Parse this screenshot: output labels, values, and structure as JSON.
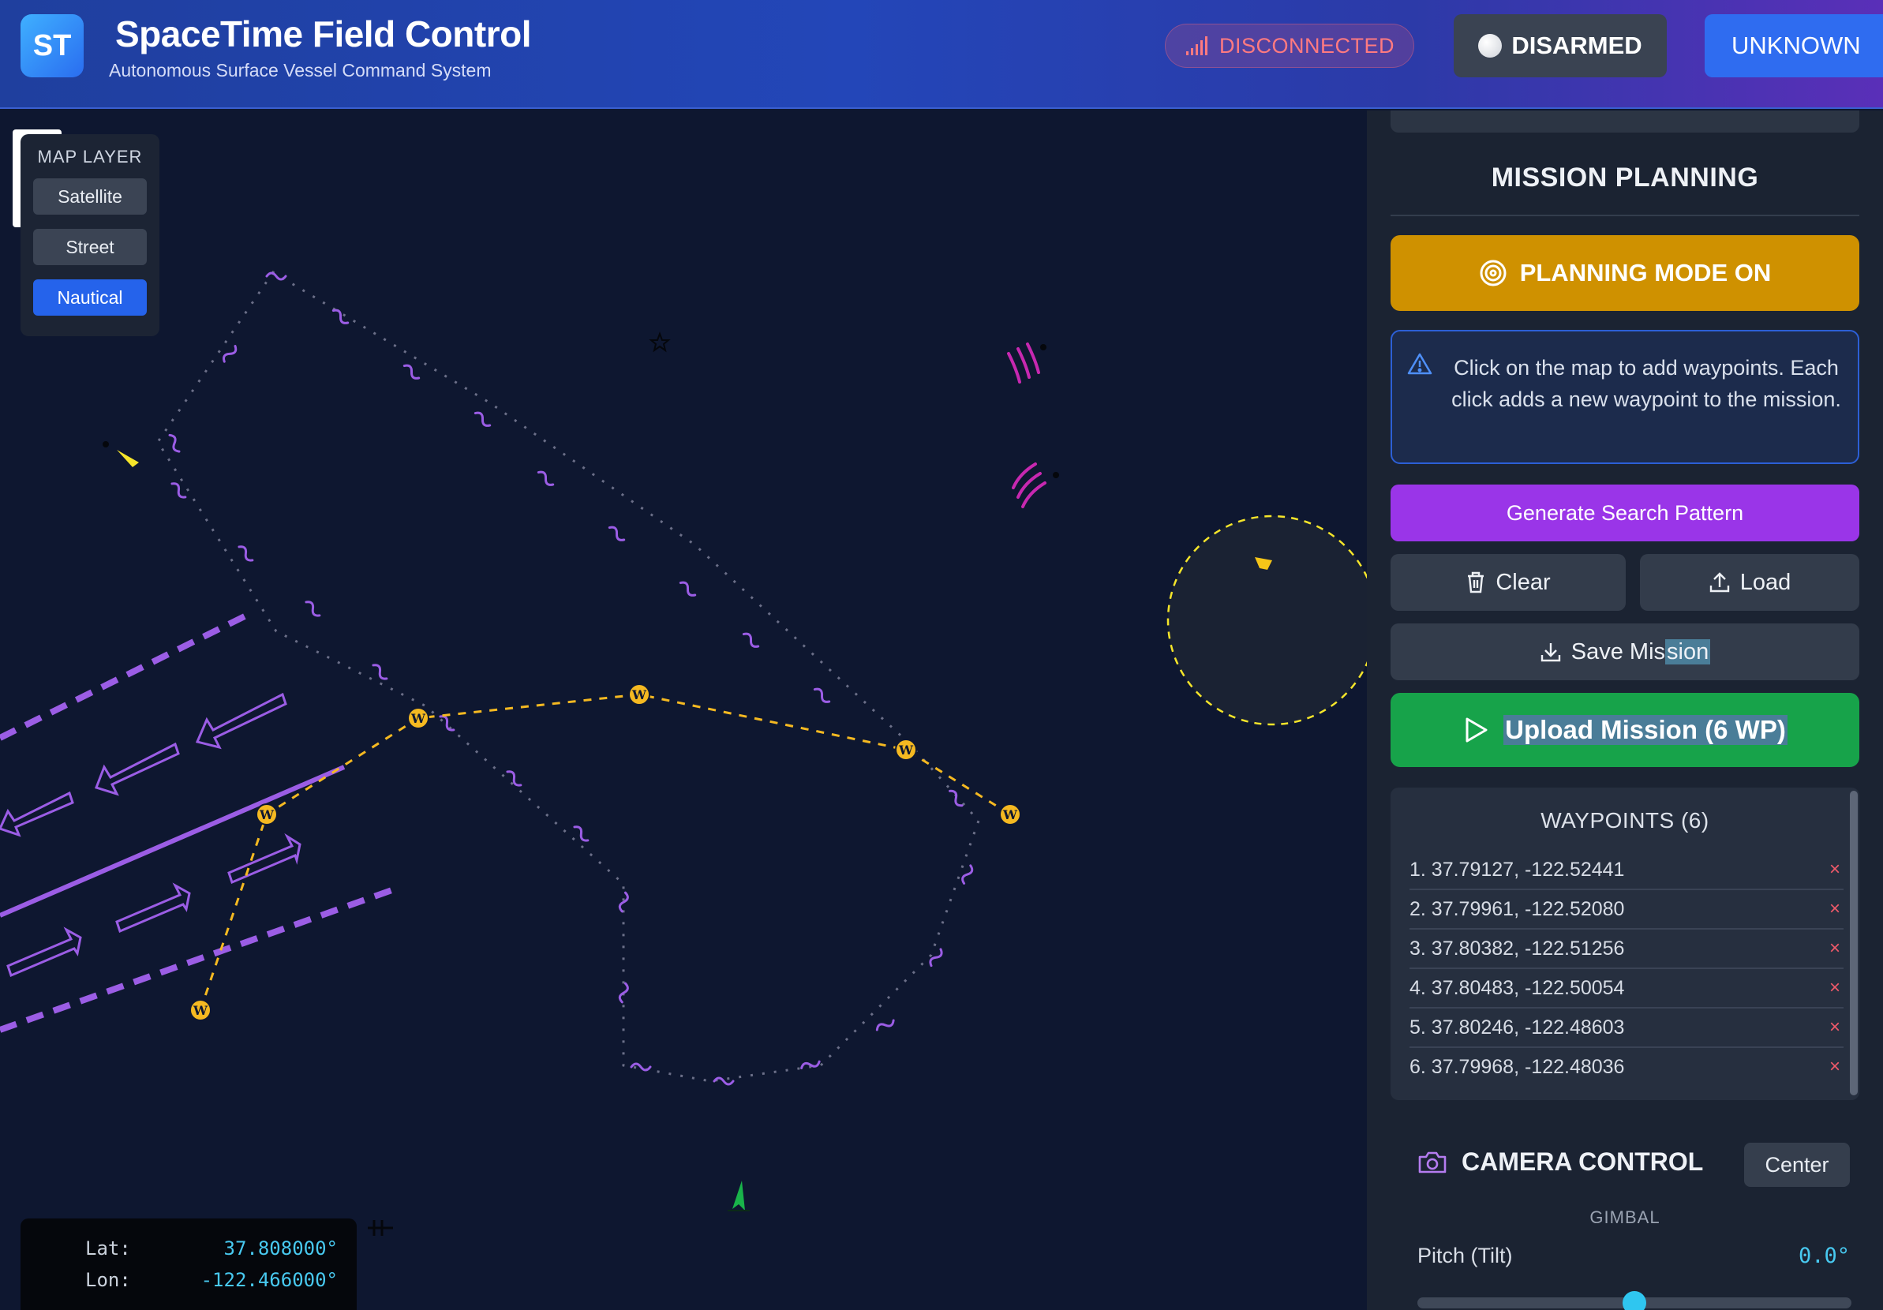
{
  "header": {
    "logo_text": "ST",
    "title": "SpaceTime Field Control",
    "subtitle": "Autonomous Surface Vessel Command System",
    "connection_status": "DISCONNECTED",
    "arm_status": "DISARMED",
    "mode": "UNKNOWN"
  },
  "map": {
    "layer_title": "MAP LAYER",
    "layers": [
      "Satellite",
      "Street",
      "Nautical"
    ],
    "active_layer": "Nautical",
    "waypoint_marker": "W",
    "coords": {
      "lat_label": "Lat:",
      "lat_value": "37.808000°",
      "lon_label": "Lon:",
      "lon_value": "-122.466000°"
    },
    "icons": [
      "compass-star-icon",
      "radio-beacon-icon",
      "buoy-flag-icon",
      "vessel-icon",
      "crosshair-icon"
    ]
  },
  "panel": {
    "mission_title": "MISSION PLANNING",
    "planning_button": "PLANNING MODE ON",
    "info_text": "Click on the map to add waypoints. Each click adds a new waypoint to the mission.",
    "generate_button": "Generate Search Pattern",
    "clear_button": "Clear",
    "load_button": "Load",
    "save_button_pre": "Save Mis",
    "save_button_sel": "sion",
    "upload_button": "Upload Mission (6 WP)",
    "waypoints_title": "WAYPOINTS (6)",
    "waypoints": [
      "1. 37.79127, -122.52441",
      "2. 37.79961, -122.52080",
      "3. 37.80382, -122.51256",
      "4. 37.80483, -122.50054",
      "5. 37.80246, -122.48603",
      "6. 37.79968, -122.48036"
    ],
    "delete_glyph": "×",
    "camera_title": "CAMERA CONTROL",
    "center_button": "Center",
    "gimbal_label": "GIMBAL",
    "pitch_label": "Pitch (Tilt)",
    "pitch_value": "0.0°",
    "pitch_fraction": 0.5
  },
  "colors": {
    "background": "#0e1730",
    "accent_blue": "#2563eb",
    "planning": "#cf9100",
    "generate": "#9a35e8",
    "upload": "#17a34a",
    "waypoint": "#f5b921",
    "route_purple": "#9b5de5",
    "danger": "#ff7a80"
  }
}
